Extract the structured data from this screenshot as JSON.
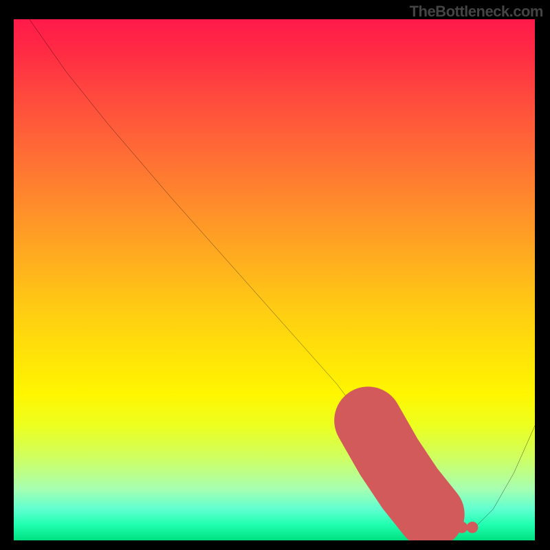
{
  "watermark": "TheBottleneck.com",
  "chart_data": {
    "type": "line",
    "title": "",
    "xlabel": "",
    "ylabel": "",
    "xlim": [
      0,
      100
    ],
    "ylim": [
      0,
      100
    ],
    "series": [
      {
        "name": "curve",
        "color": "#000000",
        "x": [
          3,
          10,
          18,
          24,
          30,
          38,
          46,
          54,
          62,
          68,
          72,
          76,
          80,
          84,
          88,
          92,
          96,
          100
        ],
        "y": [
          100,
          90,
          80,
          73,
          66,
          57,
          48,
          39,
          30,
          22,
          15,
          8,
          4,
          2,
          2,
          6,
          13,
          22
        ]
      },
      {
        "name": "highlight",
        "color": "#d25a5a",
        "x": [
          68,
          72,
          76,
          80,
          82,
          84,
          86,
          88
        ],
        "y": [
          23,
          16,
          10,
          5,
          3.5,
          2.5,
          2.5,
          2.5
        ]
      }
    ],
    "gradient_stops": [
      {
        "pos": 0,
        "color": "#ff1a4a"
      },
      {
        "pos": 25,
        "color": "#ff6a36"
      },
      {
        "pos": 50,
        "color": "#ffca14"
      },
      {
        "pos": 75,
        "color": "#ecff20"
      },
      {
        "pos": 100,
        "color": "#00e080"
      }
    ]
  }
}
